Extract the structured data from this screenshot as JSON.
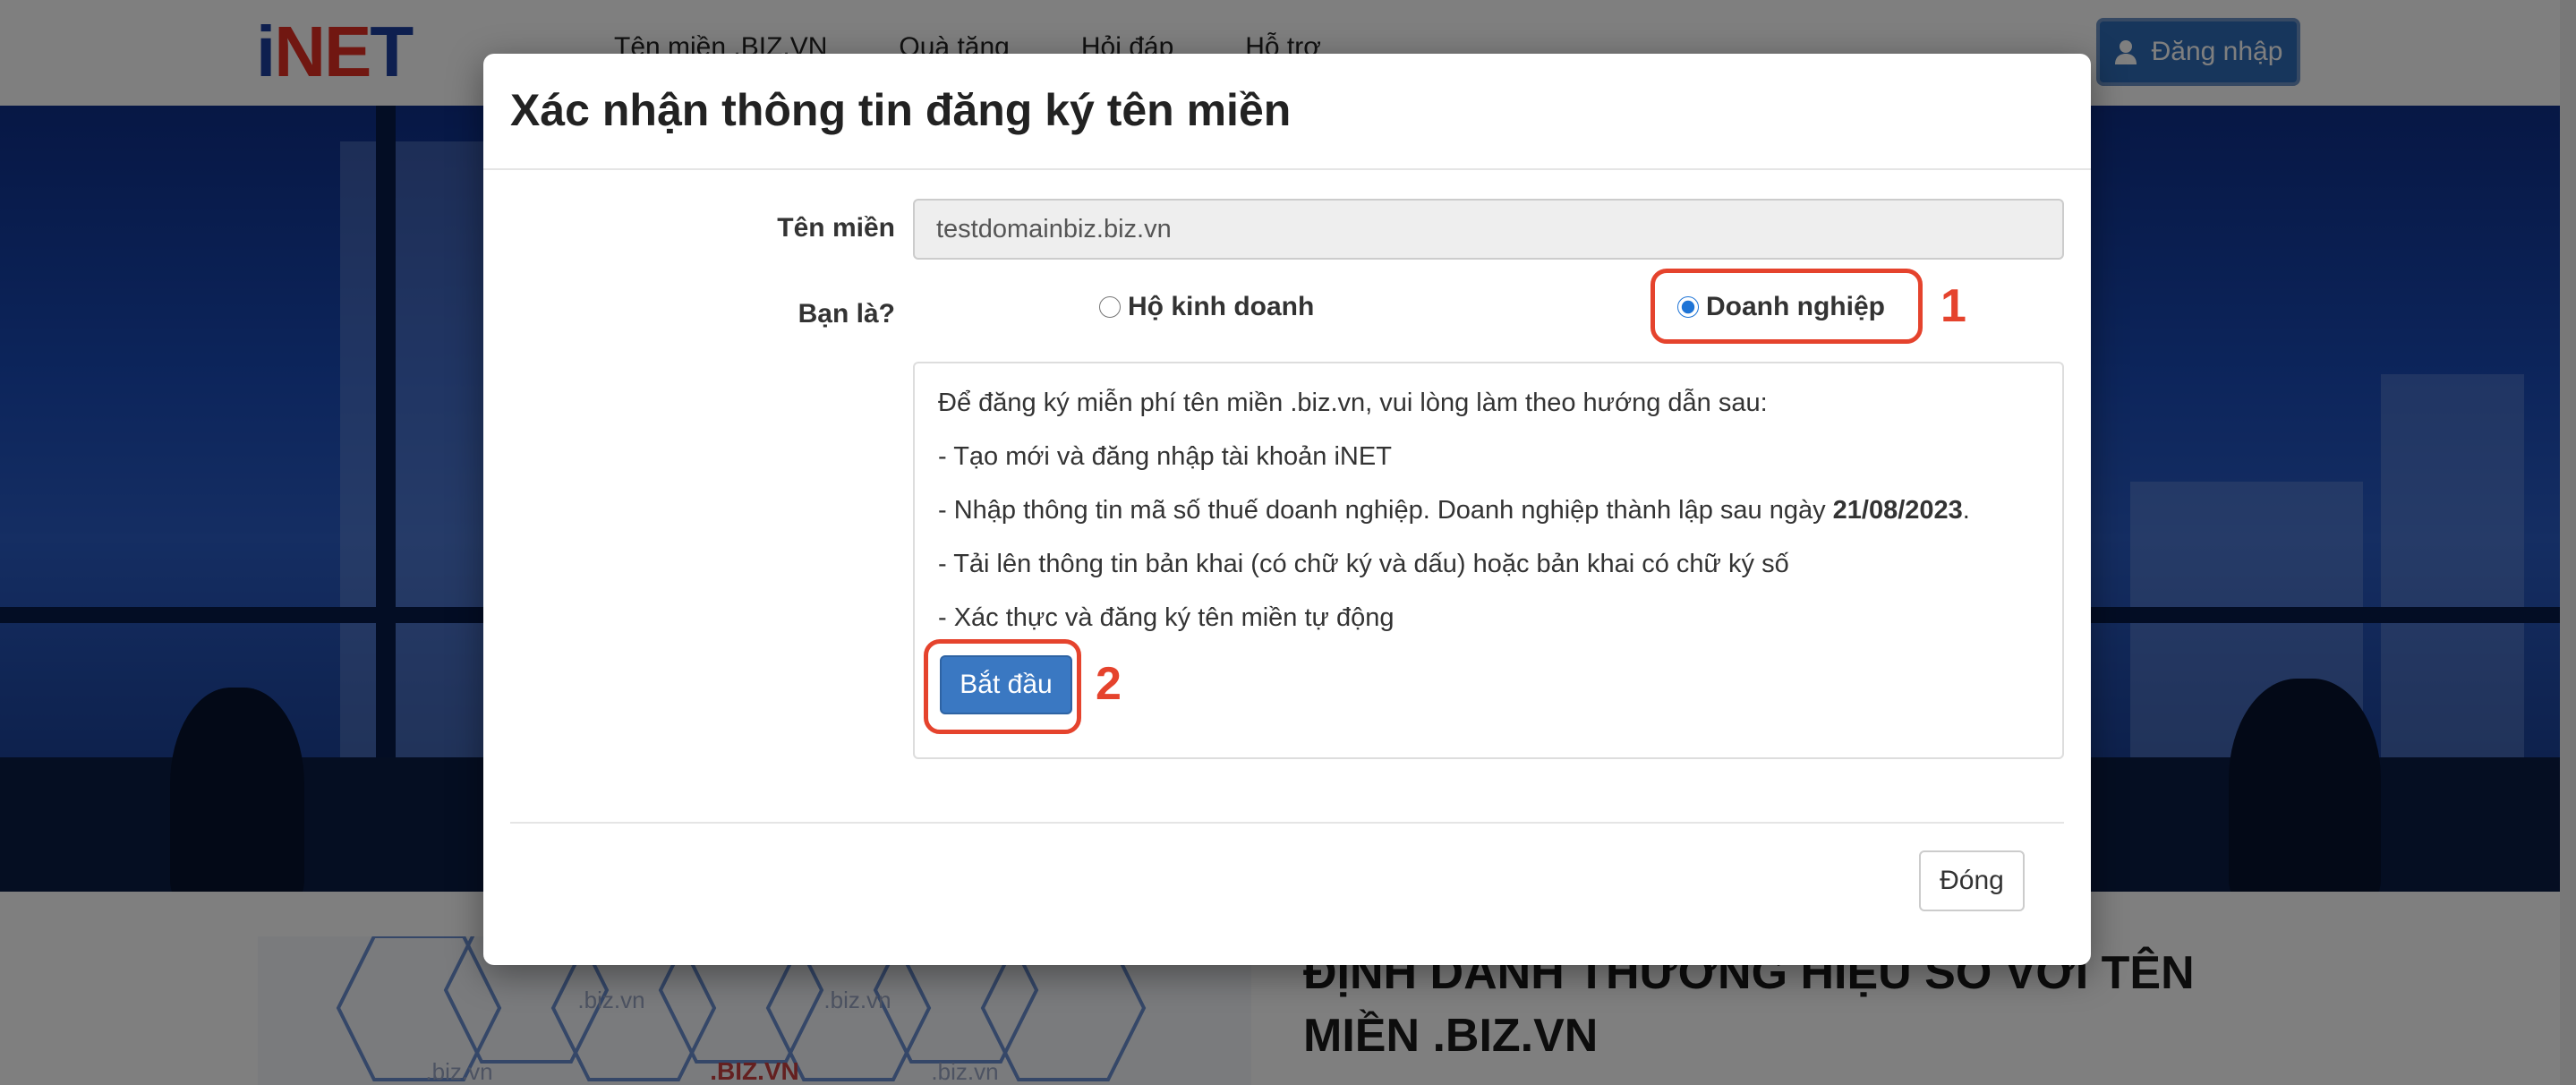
{
  "navbar": {
    "logo": {
      "part1": "i",
      "part2": "NE",
      "part3": "T"
    },
    "menu": [
      "Tên miền .BIZ.VN",
      "Quà tặng",
      "Hỏi đáp",
      "Hỗ trợ"
    ],
    "login_label": "Đăng nhập"
  },
  "page": {
    "heading": "ĐỊNH DANH THƯƠNG HIỆU SỐ VỚI TÊN MIỀN .BIZ.VN",
    "hex_labels": [
      ".biz.vn",
      ".biz.vn",
      ".BIZ.VN",
      ".biz.vn",
      ".biz.vn"
    ]
  },
  "modal": {
    "title": "Xác nhận thông tin đăng ký tên miền",
    "domain_label": "Tên miền",
    "domain_value": "testdomainbiz.biz.vn",
    "role_label": "Bạn là?",
    "options": [
      {
        "label": "Hộ kinh doanh",
        "checked": false
      },
      {
        "label": "Doanh nghiệp",
        "checked": true
      }
    ],
    "instructions": {
      "intro": "Để đăng ký miễn phí tên miền .biz.vn, vui lòng làm theo hướng dẫn sau:",
      "step1": "- Tạo mới và đăng nhập tài khoản iNET",
      "step2_prefix": "- Nhập thông tin mã số thuế doanh nghiệp. Doanh nghiệp thành lập sau ngày ",
      "step2_date": "21/08/2023",
      "step2_suffix": ".",
      "step3": "- Tải lên thông tin bản khai (có chữ ký và dấu) hoặc bản khai có chữ ký số",
      "step4": "- Xác thực và đăng ký tên miền tự động"
    },
    "start_button": "Bắt đầu",
    "close_button": "Đóng"
  },
  "annotations": {
    "marker1": "1",
    "marker2": "2",
    "color": "#e5432d"
  },
  "colors": {
    "primary": "#3a78c2",
    "login": "#2e6db8",
    "logo_blue": "#1c3f9e",
    "logo_red": "#e32e22"
  }
}
